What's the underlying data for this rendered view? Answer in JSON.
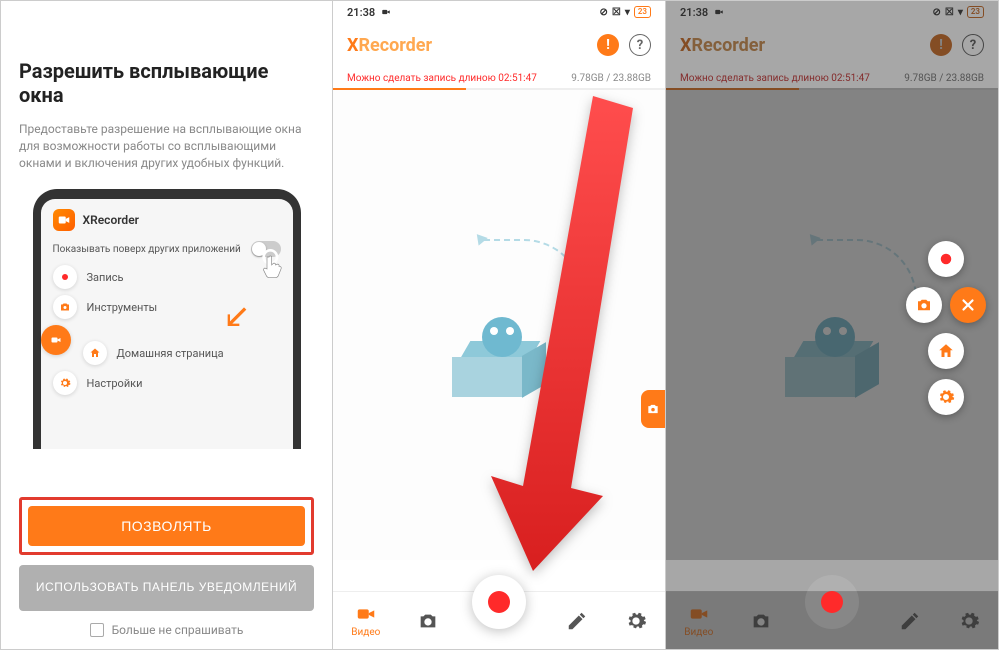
{
  "panel1": {
    "title": "Разрешить всплывающие окна",
    "description": "Предоставьте разрешение на всплывающие окна для возможности работы со всплывающими окнами и включения других удобных функций.",
    "mock": {
      "app_name": "XRecorder",
      "overlay_label": "Показывать поверх других приложений",
      "items": {
        "record": "Запись",
        "tools": "Инструменты",
        "home": "Домашняя страница",
        "settings": "Настройки"
      }
    },
    "buttons": {
      "allow": "ПОЗВОЛЯТЬ",
      "panel": "ИСПОЛЬЗОВАТЬ ПАНЕЛЬ УВЕДОМЛЕНИЙ"
    },
    "dont_ask": "Больше не спрашивать"
  },
  "panel2": {
    "time": "21:38",
    "battery": "23",
    "brand_first": "X",
    "brand_rest": "Recorder",
    "rec_note": "Можно сделать запись длиною 02:51:47",
    "storage": "9.78GB / 23.88GB",
    "nav": {
      "video": "Видео"
    }
  },
  "panel3": {
    "time": "21:38",
    "battery": "23",
    "brand_first": "X",
    "brand_rest": "Recorder",
    "rec_note": "Можно сделать запись длиною 02:51:47",
    "storage": "9.78GB / 23.88GB",
    "nav": {
      "video": "Видео"
    }
  }
}
